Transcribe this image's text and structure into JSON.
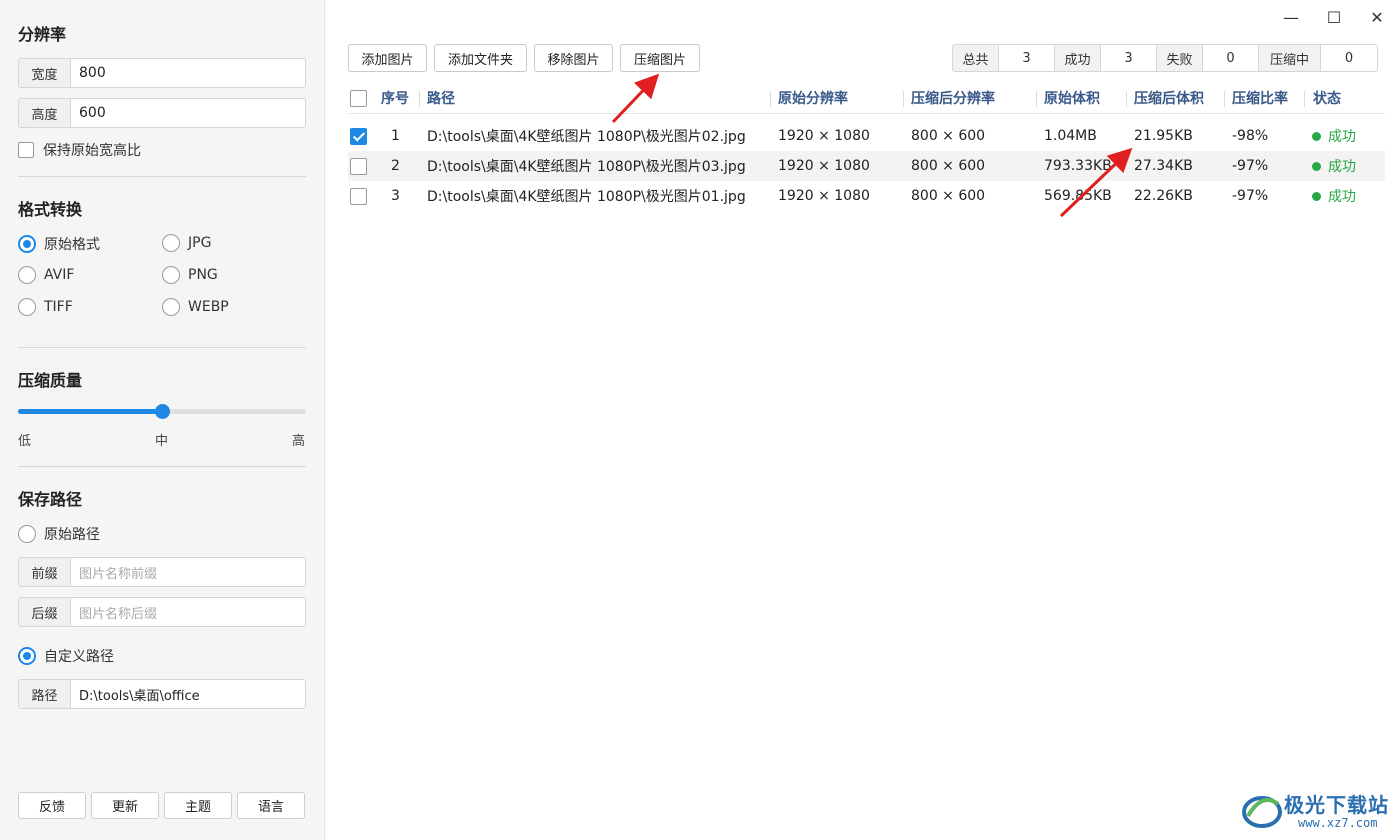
{
  "sidebar": {
    "resolution": {
      "title": "分辨率",
      "width_label": "宽度",
      "width_value": "800",
      "height_label": "高度",
      "height_value": "600",
      "keep_ratio_label": "保持原始宽高比",
      "keep_ratio_checked": false
    },
    "format": {
      "title": "格式转换",
      "options": [
        {
          "label": "原始格式",
          "selected": true
        },
        {
          "label": "JPG",
          "selected": false
        },
        {
          "label": "AVIF",
          "selected": false
        },
        {
          "label": "PNG",
          "selected": false
        },
        {
          "label": "TIFF",
          "selected": false
        },
        {
          "label": "WEBP",
          "selected": false
        }
      ]
    },
    "quality": {
      "title": "压缩质量",
      "low_label": "低",
      "mid_label": "中",
      "high_label": "高",
      "level_fraction": 0.5
    },
    "save_path": {
      "title": "保存路径",
      "original_label": "原始路径",
      "original_selected": false,
      "prefix_label": "前缀",
      "prefix_placeholder": "图片名称前缀",
      "suffix_label": "后缀",
      "suffix_placeholder": "图片名称后缀",
      "custom_label": "自定义路径",
      "custom_selected": true,
      "path_label": "路径",
      "path_value": "D:\\tools\\桌面\\office"
    },
    "bottom_buttons": [
      "反馈",
      "更新",
      "主题",
      "语言"
    ]
  },
  "window": {
    "minimize_glyph": "—",
    "maximize_glyph": "☐",
    "close_glyph": "✕"
  },
  "toolbar": {
    "add_image": "添加图片",
    "add_folder": "添加文件夹",
    "remove_image": "移除图片",
    "compress_image": "压缩图片"
  },
  "stats": {
    "total_label": "总共",
    "total_value": "3",
    "success_label": "成功",
    "success_value": "3",
    "fail_label": "失败",
    "fail_value": "0",
    "compressing_label": "压缩中",
    "compressing_value": "0"
  },
  "table": {
    "headers": {
      "index": "序号",
      "path": "路径",
      "orig_res": "原始分辨率",
      "new_res": "压缩后分辨率",
      "orig_size": "原始体积",
      "new_size": "压缩后体积",
      "ratio": "压缩比率",
      "status": "状态"
    },
    "rows": [
      {
        "checked": true,
        "index": "1",
        "path": "D:\\tools\\桌面\\4K壁纸图片 1080P\\极光图片02.jpg",
        "orig_res": "1920 × 1080",
        "new_res": "800 × 600",
        "orig_size": "1.04MB",
        "new_size": "21.95KB",
        "ratio": "-98%",
        "status": "成功"
      },
      {
        "checked": false,
        "index": "2",
        "path": "D:\\tools\\桌面\\4K壁纸图片 1080P\\极光图片03.jpg",
        "orig_res": "1920 × 1080",
        "new_res": "800 × 600",
        "orig_size": "793.33KB",
        "new_size": "27.34KB",
        "ratio": "-97%",
        "status": "成功"
      },
      {
        "checked": false,
        "index": "3",
        "path": "D:\\tools\\桌面\\4K壁纸图片 1080P\\极光图片01.jpg",
        "orig_res": "1920 × 1080",
        "new_res": "800 × 600",
        "orig_size": "569.85KB",
        "new_size": "22.26KB",
        "ratio": "-97%",
        "status": "成功"
      }
    ]
  },
  "colors": {
    "accent": "#1e88e5",
    "success": "#28a745",
    "header_text": "#3a5a8a",
    "annotation_arrow": "#e02020"
  },
  "watermark": {
    "text": "极光下载站",
    "url": "www.xz7.com"
  }
}
